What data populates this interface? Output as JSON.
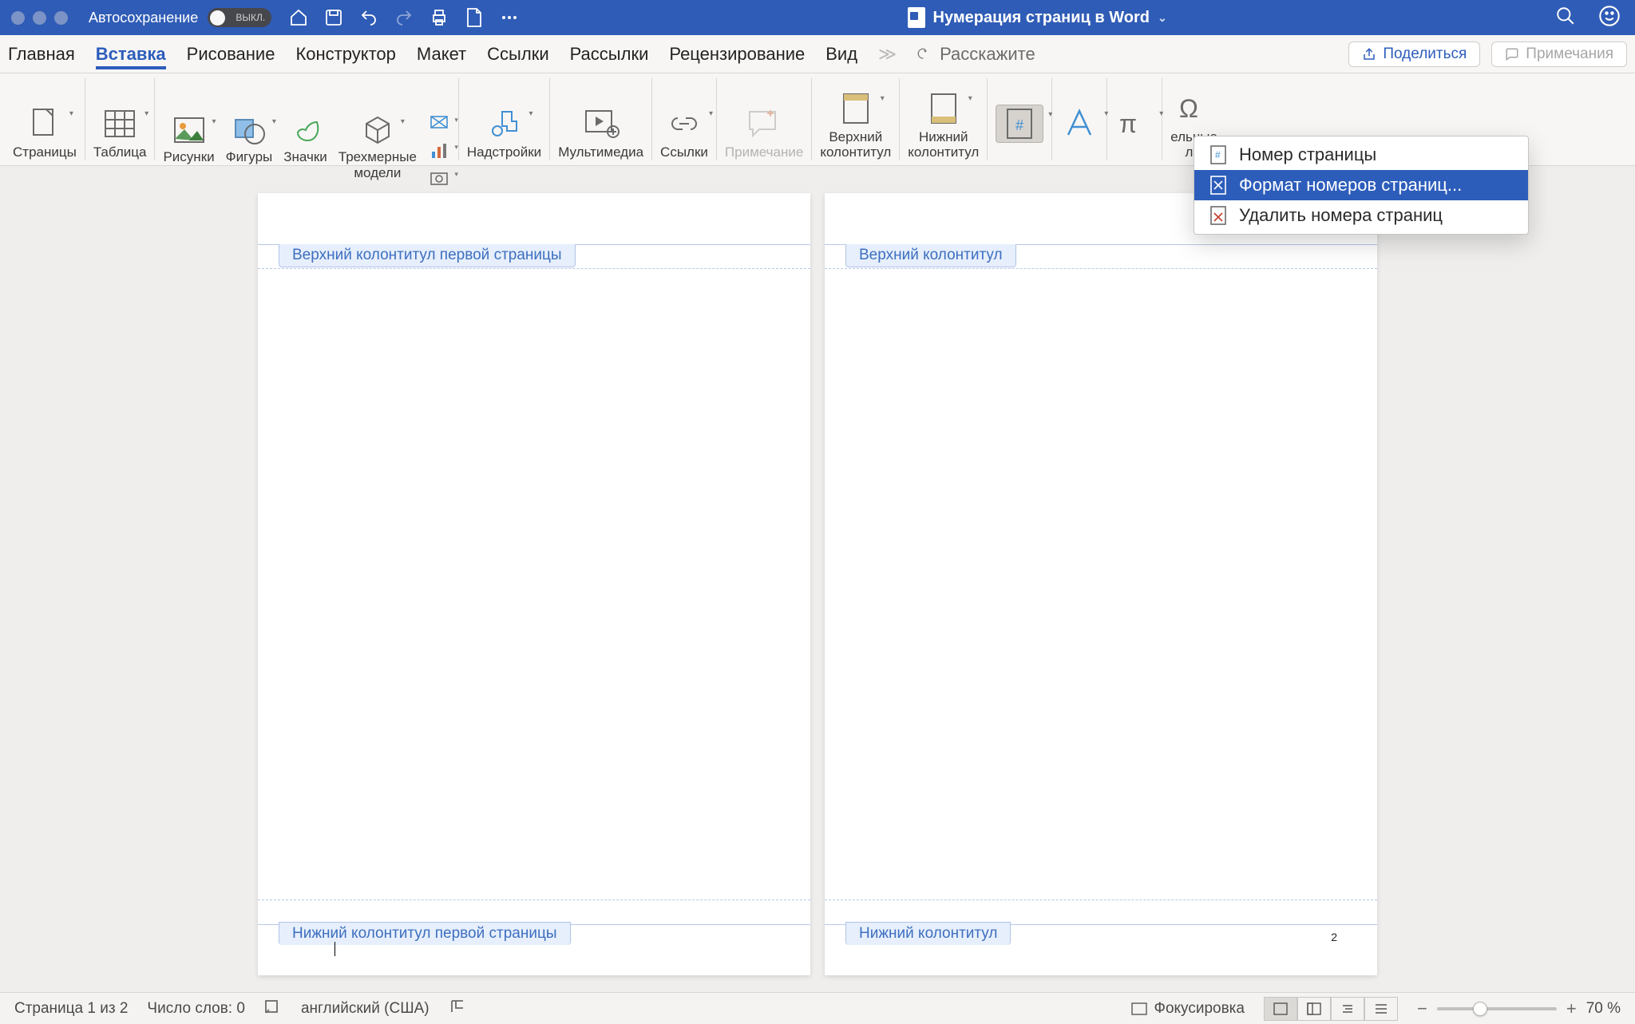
{
  "titlebar": {
    "autosave_label": "Автосохранение",
    "autosave_state": "ВЫКЛ.",
    "doc_title": "Нумерация страниц в Word"
  },
  "tabs": {
    "home": "Главная",
    "insert": "Вставка",
    "draw": "Рисование",
    "design": "Конструктор",
    "layout": "Макет",
    "references": "Ссылки",
    "mailings": "Рассылки",
    "review": "Рецензирование",
    "view": "Вид",
    "tell_me": "Расскажите"
  },
  "actions": {
    "share": "Поделиться",
    "comments": "Примечания"
  },
  "ribbon": {
    "pages": "Страницы",
    "table": "Таблица",
    "pictures": "Рисунки",
    "shapes": "Фигуры",
    "icons": "Значки",
    "models3d": "Трехмерные\nмодели",
    "addins": "Надстройки",
    "media": "Мультимедиа",
    "links": "Ссылки",
    "comment": "Примечание",
    "header": "Верхний\nколонтитул",
    "footer": "Нижний\nколонтитул",
    "fields_tail": "ельные\nлы"
  },
  "dropdown": {
    "item1": "Номер страницы",
    "item2": "Формат номеров страниц...",
    "item3": "Удалить номера страниц"
  },
  "pages": {
    "p1": {
      "header_label": "Верхний колонтитул первой страницы",
      "footer_label": "Нижний колонтитул первой страницы"
    },
    "p2": {
      "header_label": "Верхний колонтитул",
      "footer_label": "Нижний колонтитул",
      "page_number": "2"
    }
  },
  "status": {
    "page": "Страница 1 из 2",
    "words": "Число слов: 0",
    "lang": "английский (США)",
    "focus": "Фокусировка",
    "zoom": "70 %"
  }
}
